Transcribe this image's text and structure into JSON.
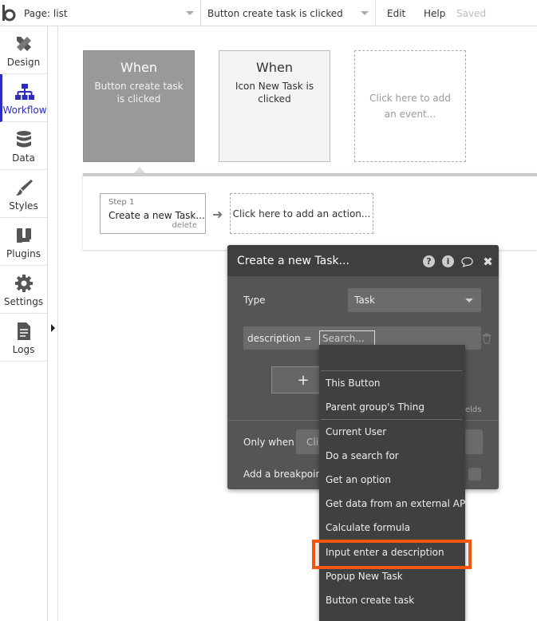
{
  "topbar": {
    "page_select": "Page: list",
    "event_select": "Button create task is clicked",
    "edit": "Edit",
    "help": "Help",
    "saved": "Saved"
  },
  "sidebar": {
    "items": [
      {
        "label": "Design",
        "icon": "design-icon"
      },
      {
        "label": "Workflow",
        "icon": "workflow-icon",
        "active": true
      },
      {
        "label": "Data",
        "icon": "database-icon"
      },
      {
        "label": "Styles",
        "icon": "brush-icon"
      },
      {
        "label": "Plugins",
        "icon": "plugin-icon"
      },
      {
        "label": "Settings",
        "icon": "gear-icon"
      },
      {
        "label": "Logs",
        "icon": "document-icon"
      }
    ]
  },
  "events": [
    {
      "when": "When",
      "name": "Button create task is clicked"
    },
    {
      "when": "When",
      "name": "Icon New Task is clicked"
    },
    {
      "placeholder": "Click here to add an event..."
    }
  ],
  "workflow": {
    "step_num": "Step 1",
    "step_title": "Create a new Task...",
    "step_delete": "delete",
    "add_action": "Click here to add an action..."
  },
  "editor": {
    "title": "Create a new Task...",
    "type_label": "Type",
    "type_value": "Task",
    "field_label": "description  =",
    "search_placeholder": "Search...",
    "set_button": "+",
    "fields_text": "elds",
    "only_when_label": "Only when",
    "only_when_placeholder": "Cli",
    "breakpoint_label": "Add a breakpoint"
  },
  "dropdown": {
    "items": [
      "This Button",
      "Parent group's Thing",
      "Current User",
      "Do a search for",
      "Get an option",
      "Get data from an external API",
      "Calculate formula",
      "Input enter a description",
      "Popup New Task",
      "Button create task"
    ],
    "highlighted": "Input enter a description"
  },
  "colors": {
    "accent": "#2b2bbf",
    "highlight": "#f5560f",
    "editor_bg": "#555555"
  }
}
